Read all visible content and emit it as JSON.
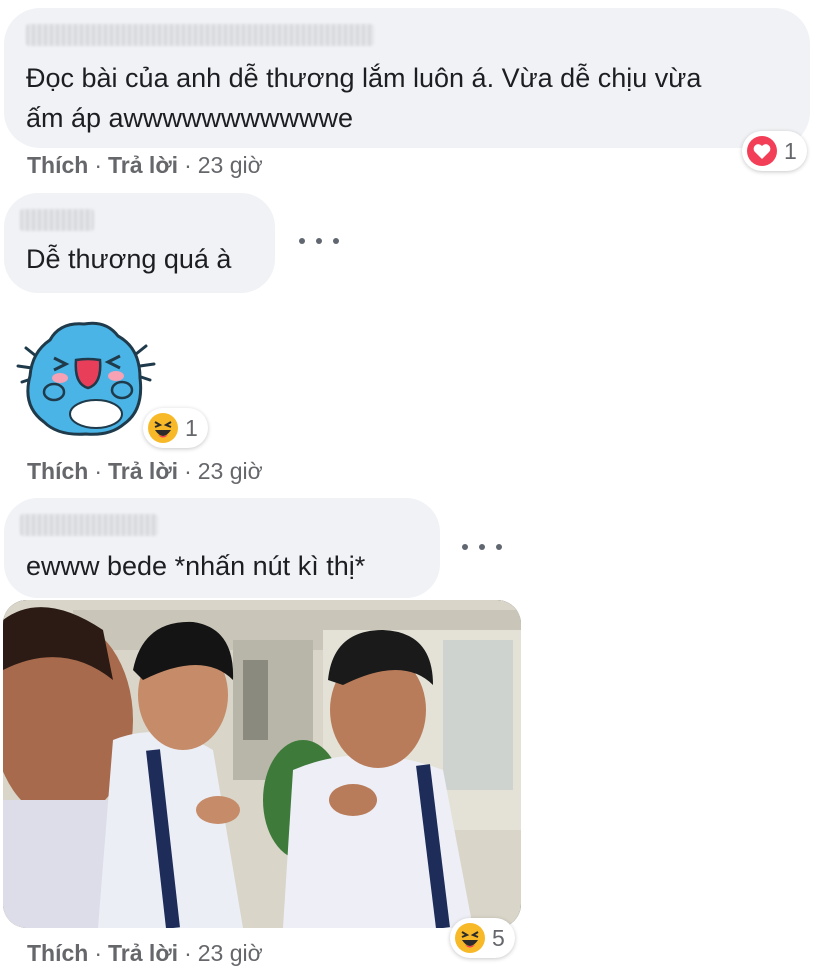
{
  "comments": [
    {
      "text_line1": "Đọc bài của anh dễ thương lắm luôn á. Vừa dễ chịu vừa",
      "text_line2": "ấm áp awwwwwwwwwwwe",
      "reaction_count": "1",
      "reaction_type": "heart-icon",
      "like": "Thích",
      "reply": "Trả lời",
      "time": "23 giờ"
    },
    {
      "text": "Dễ thương quá à"
    },
    {
      "sticker": "blue-cat-laughing-sticker",
      "reaction_count": "1",
      "reaction_type": "laughing-face-icon",
      "like": "Thích",
      "reply": "Trả lời",
      "time": "23 giờ"
    },
    {
      "text": "ewww bede *nhấn nút kì thị*",
      "image": "three-students-in-school-uniforms-photo",
      "reaction_count": "5",
      "reaction_type": "laughing-face-icon",
      "like": "Thích",
      "reply": "Trả lời",
      "time": "23 giờ"
    }
  ],
  "colors": {
    "bubble": "#f0f2f5",
    "text": "#1c1e21",
    "meta": "#65676b",
    "heart": "#f33e58",
    "haha": "#f7b928"
  }
}
